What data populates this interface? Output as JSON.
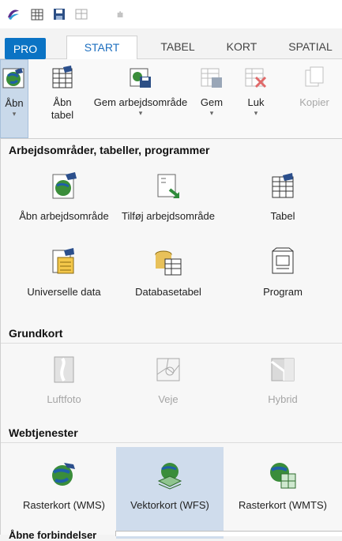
{
  "ribbon_tabs": [
    "PRO",
    "START",
    "TABEL",
    "KORT",
    "SPATIAL"
  ],
  "ribbon_buttons": [
    {
      "label": "Åbn",
      "caret": "▾"
    },
    {
      "label": "Åbn tabel",
      "caret": ""
    },
    {
      "label": "Gem arbejdsområde",
      "caret": "▾"
    },
    {
      "label": "Gem",
      "caret": "▾"
    },
    {
      "label": "Luk",
      "caret": "▾"
    },
    {
      "label": "Kopier",
      "caret": ""
    }
  ],
  "sections": {
    "workspaces": "Arbejdsområder, tabeller, programmer",
    "basemaps": "Grundkort",
    "webservices": "Webtjenester",
    "connections": "Åbne forbindelser"
  },
  "workspace_items": [
    {
      "label": "Åbn arbejdsområde"
    },
    {
      "label": "Tilføj arbejdsområde"
    },
    {
      "label": "Tabel"
    },
    {
      "label": "Universelle data"
    },
    {
      "label": "Databasetabel"
    },
    {
      "label": "Program"
    }
  ],
  "basemap_items": [
    {
      "label": "Luftfoto"
    },
    {
      "label": "Veje"
    },
    {
      "label": "Hybrid"
    }
  ],
  "web_items": [
    {
      "label": "Rasterkort (WMS)"
    },
    {
      "label": "Vektorkort (WFS)"
    },
    {
      "label": "Rasterkort (WMTS)"
    }
  ],
  "colors": {
    "accent": "#0b73c4",
    "highlight": "#cfdcec"
  }
}
